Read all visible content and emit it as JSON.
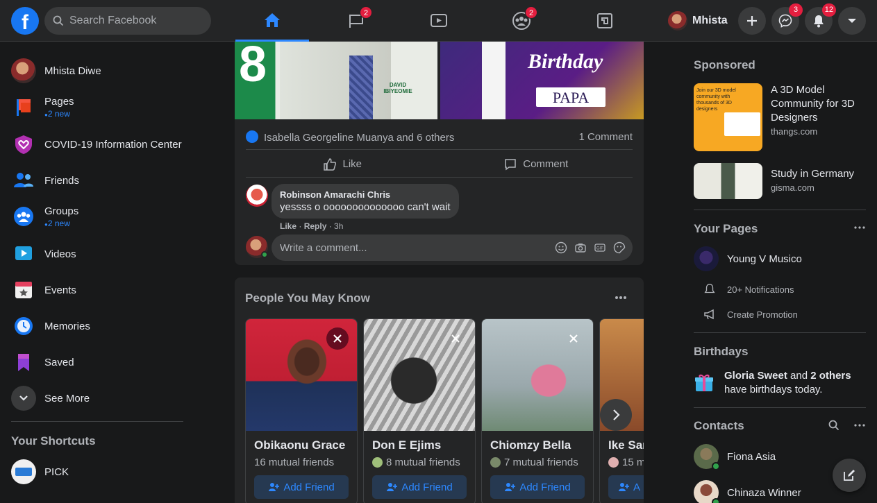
{
  "topbar": {
    "logo": "f",
    "search_placeholder": "Search Facebook",
    "tabs": [
      {
        "name": "home",
        "badge": ""
      },
      {
        "name": "pages",
        "badge": "2"
      },
      {
        "name": "watch",
        "badge": ""
      },
      {
        "name": "groups",
        "badge": "2"
      },
      {
        "name": "gaming",
        "badge": ""
      }
    ],
    "profile_name": "Mhista",
    "messenger_badge": "3",
    "notifications_badge": "12"
  },
  "sidebar": {
    "items": [
      {
        "label": "Mhista Diwe",
        "sub": ""
      },
      {
        "label": "Pages",
        "sub": "2 new"
      },
      {
        "label": "COVID-19 Information Center",
        "sub": ""
      },
      {
        "label": "Friends",
        "sub": ""
      },
      {
        "label": "Groups",
        "sub": "2 new"
      },
      {
        "label": "Videos",
        "sub": ""
      },
      {
        "label": "Events",
        "sub": ""
      },
      {
        "label": "Memories",
        "sub": ""
      },
      {
        "label": "Saved",
        "sub": ""
      },
      {
        "label": "See More",
        "sub": ""
      }
    ],
    "shortcuts_heading": "Your Shortcuts",
    "shortcuts": [
      {
        "label": "PICK"
      }
    ]
  },
  "post": {
    "image1_text": "DAVID IBIYEOMIE",
    "image2_text1": "Birthday",
    "image2_text2": "PAPA",
    "reactions_text": "Isabella Georgeline Muanya and 6 others",
    "comments_count": "1 Comment",
    "like_label": "Like",
    "comment_label": "Comment",
    "comment": {
      "author": "Robinson Amarachi Chris",
      "text": "yessss o oooooooooooooo can't wait",
      "like": "Like",
      "reply": "Reply",
      "time": "3h"
    },
    "write_placeholder": "Write a comment..."
  },
  "pymk": {
    "heading": "People You May Know",
    "add_label": "Add Friend",
    "people": [
      {
        "name": "Obikaonu Grace",
        "mutual": "16 mutual friends"
      },
      {
        "name": "Don E Ejims",
        "mutual": "8 mutual friends"
      },
      {
        "name": "Chiomzy Bella",
        "mutual": "7 mutual friends"
      },
      {
        "name": "Ike Sar",
        "mutual": "15 m"
      }
    ],
    "add_partial": "A"
  },
  "right": {
    "sponsored_heading": "Sponsored",
    "ads": [
      {
        "title": "A 3D Model Community for 3D Designers",
        "url": "thangs.com",
        "img_text": "Join our 3D model community with thousands of 3D designers"
      },
      {
        "title": "Study in Germany",
        "url": "gisma.com"
      }
    ],
    "your_pages_heading": "Your Pages",
    "page_name": "Young V Musico",
    "notifications": "20+ Notifications",
    "create_promotion": "Create Promotion",
    "birthdays_heading": "Birthdays",
    "birthday_name": "Gloria Sweet",
    "birthday_and": " and ",
    "birthday_others": "2 others",
    "birthday_suffix": "have birthdays today.",
    "contacts_heading": "Contacts",
    "contacts": [
      {
        "name": "Fiona Asia"
      },
      {
        "name": "Chinaza Winner"
      }
    ]
  },
  "colors": {
    "accent": "#2d88ff",
    "badge": "#e41e3f",
    "online": "#31a24c"
  }
}
